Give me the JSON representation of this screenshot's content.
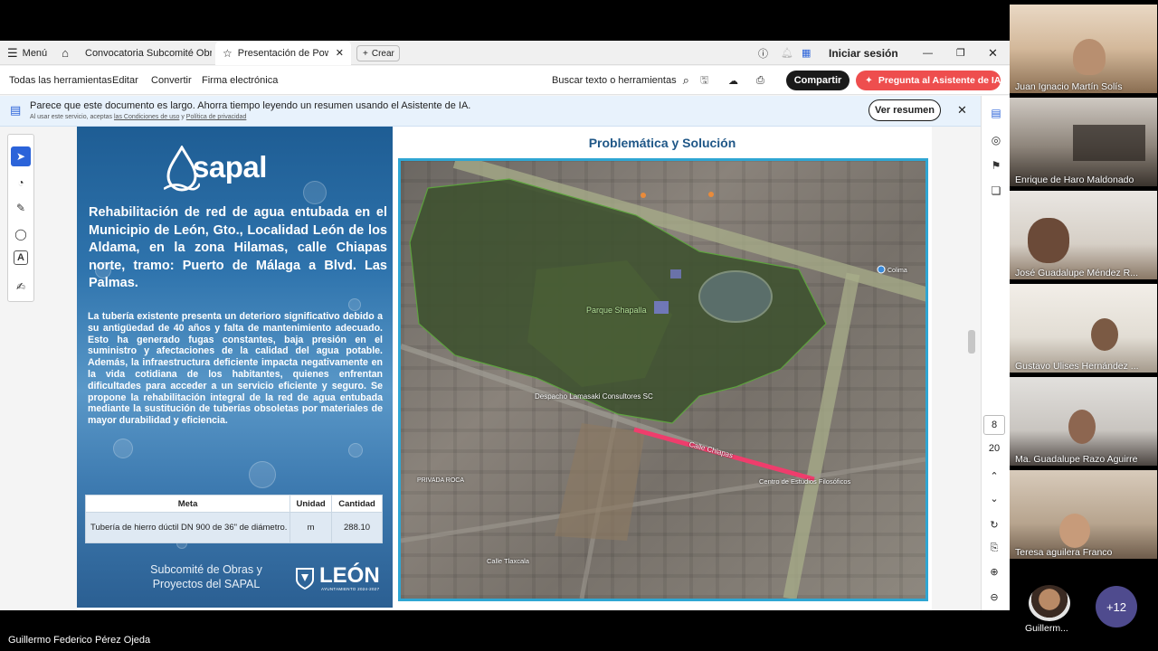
{
  "tabbar": {
    "menu_label": "Menú",
    "tabs": [
      {
        "label": "Convocatoria Subcomité Obr..."
      },
      {
        "label": "Presentación de Pow..."
      }
    ],
    "new_label": "Crear",
    "signin_label": "Iniciar sesión"
  },
  "toolbar": {
    "items": [
      "Todas las herramientas",
      "Editar",
      "Convertir",
      "Firma electrónica"
    ],
    "search_placeholder": "Buscar texto o herramientas",
    "share_label": "Compartir",
    "ai_label": "Pregunta al Asistente de IA"
  },
  "notice": {
    "text": "Parece que este documento es largo. Ahorra tiempo leyendo un resumen usando el Asistente de IA.",
    "subtext_prefix": "Al usar este servicio, aceptas",
    "link1": "las Condiciones de uso",
    "subtext_mid": "y",
    "link2": "Política de privacidad",
    "button_label": "Ver resumen"
  },
  "slide": {
    "logo_text": "sapal",
    "title": "Rehabilitación de red de agua entubada en el Municipio de León, Gto., Localidad León de los Aldama, en la zona Hilamas, calle Chiapas norte, tramo: Puerto de Málaga a Blvd. Las Palmas.",
    "body": "La tubería existente presenta un deterioro significativo debido a su antigüedad de 40 años y falta de mantenimiento adecuado. Esto ha generado fugas constantes, baja presión en el suministro y afectaciones de la calidad del agua potable. Además, la infraestructura deficiente impacta negativamente en la vida cotidiana de los habitantes, quienes enfrentan dificultades para acceder a un servicio eficiente y seguro. Se propone la rehabilitación integral de la red de agua entubada mediante la sustitución de tuberías obsoletas por materiales de mayor durabilidad y eficiencia.",
    "table": {
      "headers": [
        "Meta",
        "Unidad",
        "Cantidad"
      ],
      "rows": [
        {
          "meta": "Tubería de hierro dúctil DN 900 de 36\" de diámetro.",
          "unidad": "m",
          "cantidad": "288.10"
        }
      ]
    },
    "footer_text": "Subcomité de Obras y Proyectos del SAPAL",
    "leon_logo": "LEÓN",
    "leon_sub": "AYUNTAMIENTO 2024-2027",
    "right_title": "Problemática y Solución",
    "map_labels": {
      "park": "Parque Shapalla",
      "business": "Despacho Lamasaki Consultores SC",
      "street": "Calle Chiapas",
      "place": "Centro de Estudios Filosóficos",
      "street2": "Calle Tlaxcala",
      "priv": "PRIVADA ROCA",
      "corner": "Colima"
    }
  },
  "pager": {
    "current": "8",
    "total": "20"
  },
  "participants": [
    {
      "name": "Juan Ignacio Martín Solís"
    },
    {
      "name": "Enrique de Haro Maldonado"
    },
    {
      "name": "José Guadalupe Méndez R..."
    },
    {
      "name": "Gustavo Ulises Hernández ..."
    },
    {
      "name": "Ma. Guadalupe Razo Aguirre"
    },
    {
      "name": "Teresa aguilera Franco"
    }
  ],
  "overflow": {
    "avatar_name": "Guillerm...",
    "more_count": "+12"
  },
  "presenter_name": "Guillermo Federico Pérez Ojeda",
  "colors": {
    "accent_red": "#ee4e4e",
    "map_border": "#2fa6d3",
    "slide_blue": "#1f5787"
  }
}
